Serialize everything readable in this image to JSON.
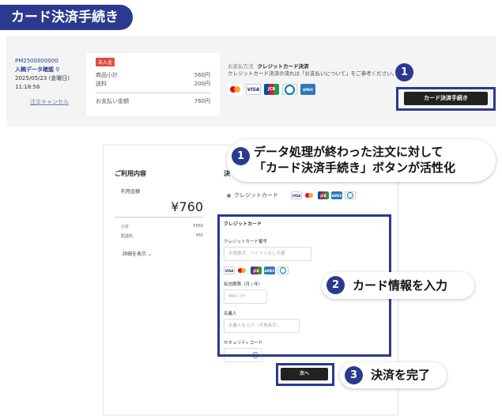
{
  "page_title": "カード決済手続き",
  "order": {
    "id": "PM2500000000",
    "link": "入稿データ確認",
    "date": "2025/05/23 (金曜日)",
    "time": "11:18:56",
    "cancel": "注文キャンセル"
  },
  "summary": {
    "badge": "未入金",
    "subtotal_label": "商品小計",
    "subtotal_value": "560円",
    "shipping_label": "送料",
    "shipping_value": "200円",
    "total_label": "お支払い金額",
    "total_value": "760円"
  },
  "payment": {
    "method_label": "お支払方法",
    "method_value": "クレジットカード決済",
    "note": "クレジットカード決済の流れは「お支払いについて」をご参考ください。",
    "button": "カード決済手続き"
  },
  "brands": [
    {
      "name": "mastercard",
      "label": ""
    },
    {
      "name": "visa",
      "label": "VISA"
    },
    {
      "name": "jcb",
      "label": "JCB"
    },
    {
      "name": "diners",
      "label": ""
    },
    {
      "name": "amex",
      "label": "AMEX"
    }
  ],
  "step1": {
    "num": "1",
    "line1": "データ処理が終わった注文に対して",
    "line2": "「カード決済手続き」ボタンが活性化"
  },
  "step2": {
    "num": "2",
    "text": "カード情報を入力"
  },
  "step3": {
    "num": "3",
    "text": "決済を完了"
  },
  "checkout": {
    "usage_title": "ご利用内容",
    "amount_label": "利用金額",
    "amount": "¥760",
    "small_subtotal_label": "小計",
    "small_subtotal_value": "¥560",
    "small_shipping_label": "配送料",
    "small_shipping_value": "¥65",
    "details": "詳細を表示",
    "right_title": "決",
    "radio_label": "クレジットカード",
    "form_title": "クレジットカード",
    "card_number_label": "クレジットカード番号",
    "card_number_placeholder": "半角数字、ハイフンなし不要",
    "expiry_label": "有効期限（月 / 年）",
    "expiry_placeholder": "MM / YY",
    "name_label": "名義人",
    "name_placeholder": "名義人を入力（半角英字）",
    "security_label": "セキュリティコード",
    "next_button": "次へ"
  },
  "colors": {
    "navy": "#2b3990",
    "badge_red": "#e24b3b",
    "button_dark": "#222222"
  }
}
